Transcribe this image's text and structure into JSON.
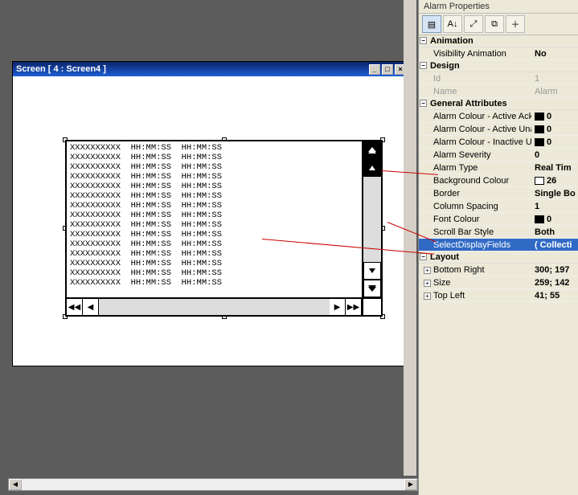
{
  "window": {
    "title": "Screen  [ 4  :  Screen4  ]"
  },
  "list_rows": [
    "XXXXXXXXXX  HH:MM:SS  HH:MM:SS",
    "XXXXXXXXXX  HH:MM:SS  HH:MM:SS",
    "XXXXXXXXXX  HH:MM:SS  HH:MM:SS",
    "XXXXXXXXXX  HH:MM:SS  HH:MM:SS",
    "XXXXXXXXXX  HH:MM:SS  HH:MM:SS",
    "XXXXXXXXXX  HH:MM:SS  HH:MM:SS",
    "XXXXXXXXXX  HH:MM:SS  HH:MM:SS",
    "XXXXXXXXXX  HH:MM:SS  HH:MM:SS",
    "XXXXXXXXXX  HH:MM:SS  HH:MM:SS",
    "XXXXXXXXXX  HH:MM:SS  HH:MM:SS",
    "XXXXXXXXXX  HH:MM:SS  HH:MM:SS",
    "XXXXXXXXXX  HH:MM:SS  HH:MM:SS",
    "XXXXXXXXXX  HH:MM:SS  HH:MM:SS",
    "XXXXXXXXXX  HH:MM:SS  HH:MM:SS",
    "XXXXXXXXXX  HH:MM:SS  HH:MM:SS"
  ],
  "panel": {
    "title": "Alarm Properties",
    "cats": {
      "animation": "Animation",
      "design": "Design",
      "general": "General Attributes",
      "layout": "Layout"
    },
    "rows": {
      "visibility": {
        "n": "Visibility Animation",
        "v": "No"
      },
      "id": {
        "n": "Id",
        "v": "1"
      },
      "name": {
        "n": "Name",
        "v": "Alarm"
      },
      "acAck": {
        "n": "Alarm Colour - Active Ack",
        "v": "0"
      },
      "acUna": {
        "n": "Alarm Colour - Active Una",
        "v": "0"
      },
      "acInu": {
        "n": "Alarm Colour - Inactive Un",
        "v": "0"
      },
      "sev": {
        "n": "Alarm Severity",
        "v": "0"
      },
      "type": {
        "n": "Alarm Type",
        "v": "Real Tim"
      },
      "bg": {
        "n": "Background Colour",
        "v": "26"
      },
      "border": {
        "n": "Border",
        "v": "Single Bo"
      },
      "spacing": {
        "n": "Column Spacing",
        "v": "1"
      },
      "font": {
        "n": "Font Colour",
        "v": "0"
      },
      "scroll": {
        "n": "Scroll Bar Style",
        "v": "Both"
      },
      "select": {
        "n": "SelectDisplayFields",
        "v": "( Collecti"
      },
      "br": {
        "n": "Bottom Right",
        "v": "300; 197"
      },
      "size": {
        "n": "Size",
        "v": "259; 142"
      },
      "tl": {
        "n": "Top Left",
        "v": "41; 55"
      }
    }
  }
}
